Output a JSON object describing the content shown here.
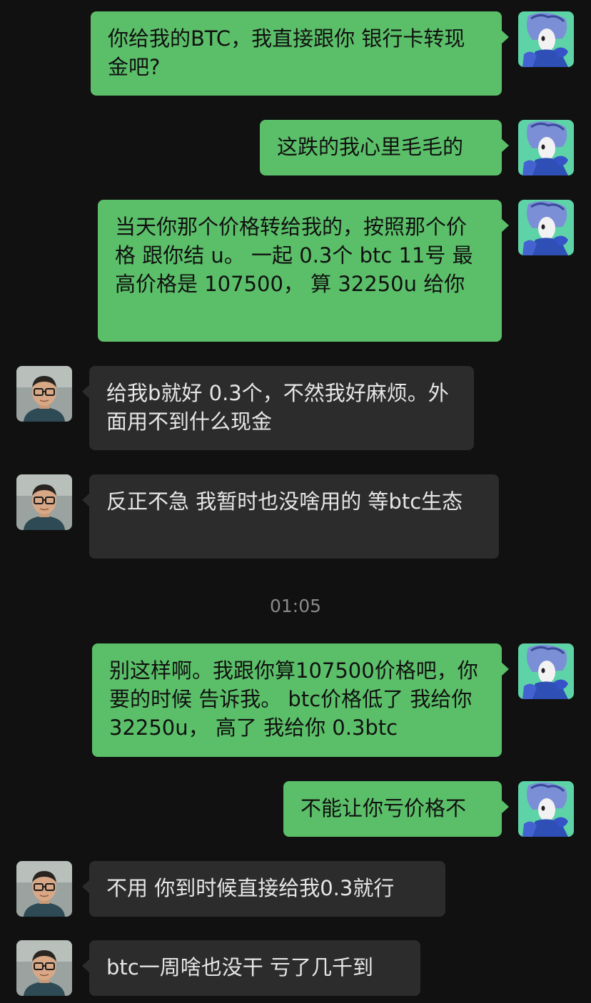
{
  "conversation": {
    "messages": [
      {
        "sender": "me",
        "text": "你给我的BTC，我直接跟你 银行卡转现金吧?"
      },
      {
        "sender": "me",
        "text": "这跌的我心里毛毛的"
      },
      {
        "sender": "me",
        "text": "当天你那个价格转给我的，按照那个价格 跟你结 u。 一起 0.3个 btc 11号 最高价格是 107500， 算 32250u 给你"
      },
      {
        "sender": "them",
        "text": "给我b就好 0.3个，不然我好麻烦。外面用不到什么现金"
      },
      {
        "sender": "them",
        "text": "反正不急 我暂时也没啥用的 等btc生态"
      },
      {
        "sender": "me",
        "text": "别这样啊。我跟你算107500价格吧，你要的时候 告诉我。 btc价格低了 我给你 32250u， 高了 我给你 0.3btc"
      },
      {
        "sender": "me",
        "text": "不能让你亏价格不"
      },
      {
        "sender": "them",
        "text": "不用 你到时候直接给我0.3就行"
      },
      {
        "sender": "them",
        "text": "btc一周啥也没干 亏了几千到"
      }
    ],
    "timestamp": "01:05"
  },
  "colors": {
    "background": "#111111",
    "my_bubble": "#5bbf69",
    "their_bubble": "#2c2c2c",
    "timestamp_text": "#8a8a8a"
  },
  "icons": {
    "my_avatar": "anime-character-avatar-icon",
    "their_avatar": "man-with-glasses-avatar-icon"
  }
}
